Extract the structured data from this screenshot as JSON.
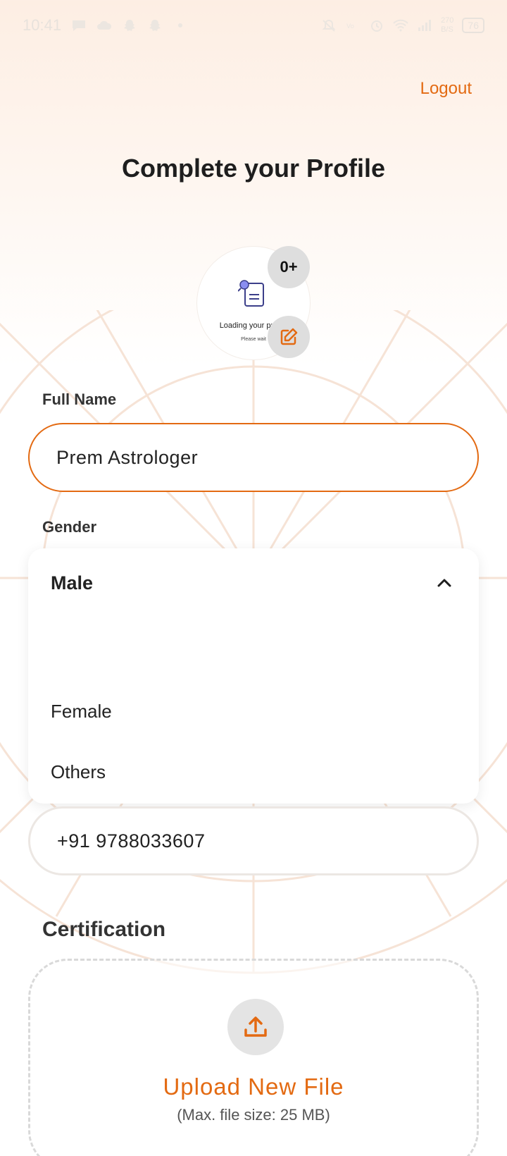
{
  "status_bar": {
    "time": "10:41",
    "net_speed_top": "270",
    "net_speed_unit": "B/S",
    "battery": "76"
  },
  "header": {
    "logout_label": "Logout",
    "title": "Complete your Profile"
  },
  "avatar": {
    "loading_text": "Loading your profile",
    "loading_sub": "Please wait",
    "count_badge": "0+"
  },
  "form": {
    "full_name_label": "Full Name",
    "full_name_value": "Prem Astrologer",
    "gender_label": "Gender",
    "gender_selected": "Male",
    "gender_options": [
      "Female",
      "Others"
    ],
    "phone_value": "+91 9788033607",
    "certification_label": "Certification",
    "upload_title": "Upload New File",
    "upload_hint": "(Max. file size: 25 MB)"
  },
  "colors": {
    "accent": "#e36a12",
    "badge_bg": "#dedede"
  }
}
